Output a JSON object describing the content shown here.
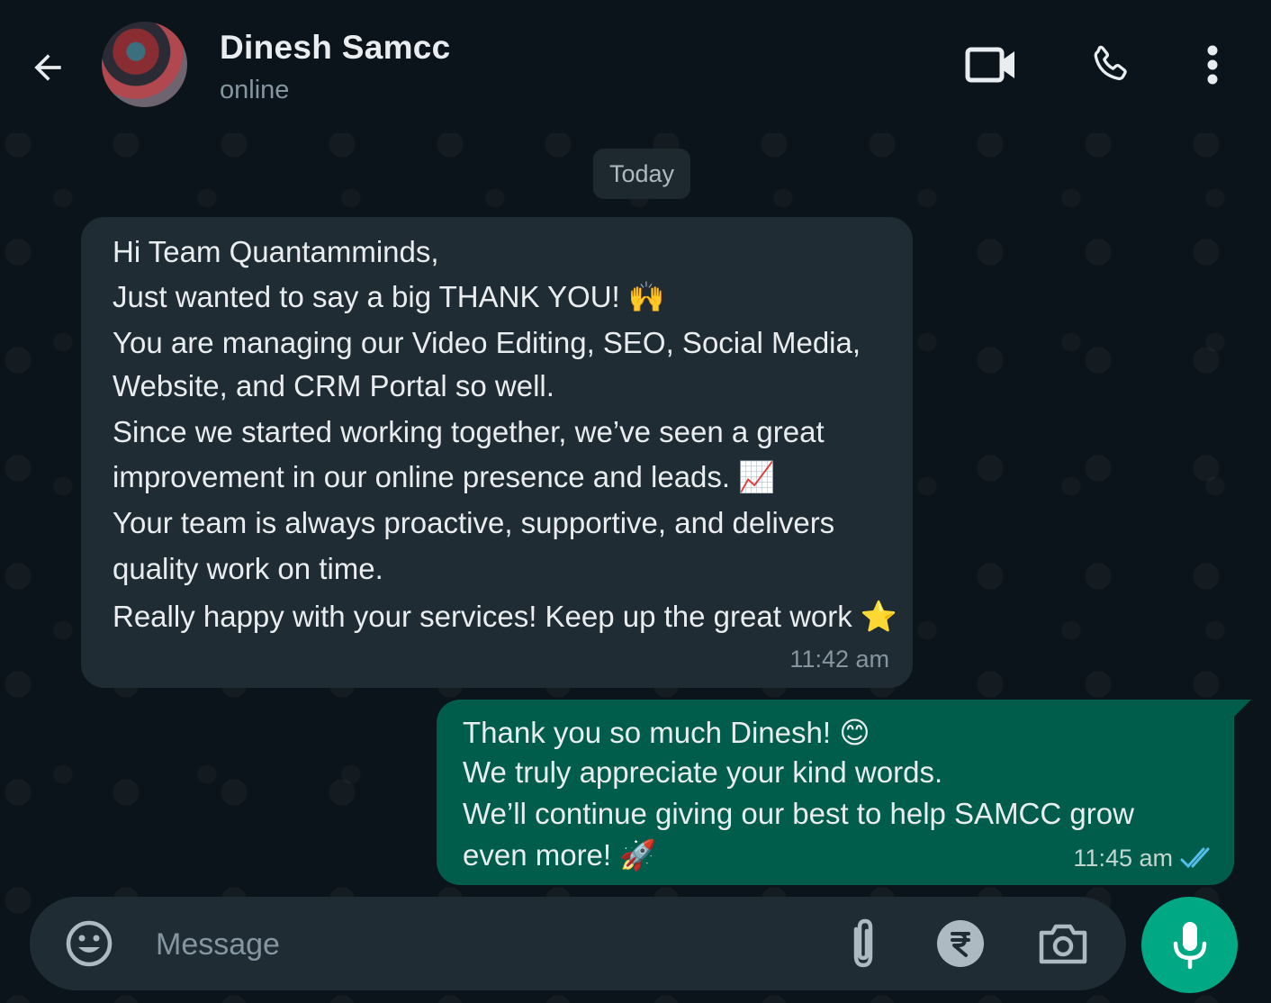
{
  "header": {
    "contact_name": "Dinesh Samcc",
    "status": "online",
    "icons": {
      "back": "back-arrow-icon",
      "video": "video-call-icon",
      "call": "phone-icon",
      "menu": "more-vertical-icon"
    }
  },
  "date_chip": "Today",
  "messages": [
    {
      "direction": "incoming",
      "lines": [
        "Hi Team Quantamminds,",
        "Just wanted to say a big THANK YOU! 🙌",
        "You are managing our Video Editing, SEO, Social Media,",
        "Website, and CRM Portal so well.",
        "Since we started working together, we’ve seen a great",
        "improvement in our online presence and leads. 📈",
        "Your team is always proactive, supportive, and delivers",
        "quality work on time.",
        "Really happy with your services! Keep up the great work ⭐"
      ],
      "time": "11:42 am"
    },
    {
      "direction": "outgoing",
      "lines": [
        "Thank you so much Dinesh! 😊",
        "We truly appreciate your kind words.",
        "We’ll continue giving our best to help SAMCC grow",
        "even more! 🚀"
      ],
      "time": "11:45 am",
      "status": "read"
    }
  ],
  "input": {
    "placeholder": "Message",
    "value": ""
  },
  "colors": {
    "background": "#0b141a",
    "incoming_bubble": "#202c33",
    "outgoing_bubble": "#005c4b",
    "accent": "#00a884",
    "read_ticks": "#53bdeb"
  }
}
